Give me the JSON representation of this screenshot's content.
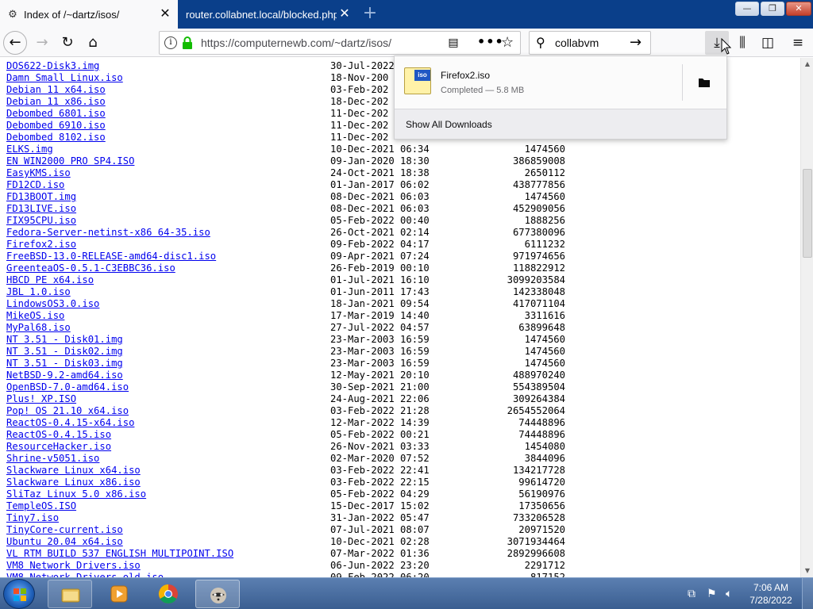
{
  "tabs": [
    {
      "title": "Index of /~dartz/isos/",
      "active": true
    },
    {
      "title": "router.collabnet.local/blocked.php",
      "active": false
    }
  ],
  "window_controls": {
    "minimize": "—",
    "maximize": "❐",
    "close": "✕"
  },
  "navbar": {
    "url": "https://computernewb.com/~dartz/isos/",
    "search_query": "collabvm"
  },
  "downloads_panel": {
    "file_name": "Firefox2.iso",
    "file_tag": "iso",
    "status": "Completed — 5.8 MB",
    "footer": "Show All Downloads"
  },
  "files": [
    {
      "name": "DOS622-Disk3.img",
      "date": "30-Jul-2022 ",
      "size": ""
    },
    {
      "name": "Damn Small Linux.iso",
      "date": "18-Nov-200",
      "size": ""
    },
    {
      "name": "Debian 11 x64.iso",
      "date": "03-Feb-202",
      "size": ""
    },
    {
      "name": "Debian 11 x86.iso",
      "date": "18-Dec-202",
      "size": ""
    },
    {
      "name": "Debombed 6801.iso",
      "date": "11-Dec-202",
      "size": ""
    },
    {
      "name": "Debombed 6910.iso",
      "date": "11-Dec-202",
      "size": ""
    },
    {
      "name": "Debombed 8102.iso",
      "date": "11-Dec-202",
      "size": ""
    },
    {
      "name": "ELKS.img",
      "date": "10-Dec-2021 06:34",
      "size": "1474560"
    },
    {
      "name": "EN WIN2000 PRO SP4.ISO",
      "date": "09-Jan-2020 18:30",
      "size": "386859008"
    },
    {
      "name": "EasyKMS.iso",
      "date": "24-Oct-2021 18:38",
      "size": "2650112"
    },
    {
      "name": "FD12CD.iso",
      "date": "01-Jan-2017 06:02",
      "size": "438777856"
    },
    {
      "name": "FD13BOOT.img",
      "date": "08-Dec-2021 06:03",
      "size": "1474560"
    },
    {
      "name": "FD13LIVE.iso",
      "date": "08-Dec-2021 06:03",
      "size": "452909056"
    },
    {
      "name": "FIX95CPU.iso",
      "date": "05-Feb-2022 00:40",
      "size": "1888256"
    },
    {
      "name": "Fedora-Server-netinst-x86 64-35.iso",
      "date": "26-Oct-2021 02:14",
      "size": "677380096"
    },
    {
      "name": "Firefox2.iso",
      "date": "09-Feb-2022 04:17",
      "size": "6111232"
    },
    {
      "name": "FreeBSD-13.0-RELEASE-amd64-disc1.iso",
      "date": "09-Apr-2021 07:24",
      "size": "971974656"
    },
    {
      "name": "GreenteaOS-0.5.1-C3EBBC36.iso",
      "date": "26-Feb-2019 00:10",
      "size": "118822912"
    },
    {
      "name": "HBCD PE x64.iso",
      "date": "01-Jul-2021 16:10",
      "size": "3099203584"
    },
    {
      "name": "JBL 1.0.iso",
      "date": "01-Jun-2011 17:43",
      "size": "142338048"
    },
    {
      "name": "LindowsOS3.0.iso",
      "date": "18-Jan-2021 09:54",
      "size": "417071104"
    },
    {
      "name": "MikeOS.iso",
      "date": "17-Mar-2019 14:40",
      "size": "3311616"
    },
    {
      "name": "MyPal68.iso",
      "date": "27-Jul-2022 04:57",
      "size": "63899648"
    },
    {
      "name": "NT 3.51 - Disk01.img",
      "date": "23-Mar-2003 16:59",
      "size": "1474560"
    },
    {
      "name": "NT 3.51 - Disk02.img",
      "date": "23-Mar-2003 16:59",
      "size": "1474560"
    },
    {
      "name": "NT 3.51 - Disk03.img",
      "date": "23-Mar-2003 16:59",
      "size": "1474560"
    },
    {
      "name": "NetBSD-9.2-amd64.iso",
      "date": "12-May-2021 20:10",
      "size": "488970240"
    },
    {
      "name": "OpenBSD-7.0-amd64.iso",
      "date": "30-Sep-2021 21:00",
      "size": "554389504"
    },
    {
      "name": "Plus! XP.ISO",
      "date": "24-Aug-2021 22:06",
      "size": "309264384"
    },
    {
      "name": "Pop! OS 21.10 x64.iso",
      "date": "03-Feb-2022 21:28",
      "size": "2654552064"
    },
    {
      "name": "ReactOS-0.4.15-x64.iso",
      "date": "12-Mar-2022 14:39",
      "size": "74448896"
    },
    {
      "name": "ReactOS-0.4.15.iso",
      "date": "05-Feb-2022 00:21",
      "size": "74448896"
    },
    {
      "name": "ResourceHacker.iso",
      "date": "26-Nov-2021 03:33",
      "size": "1454080"
    },
    {
      "name": "Shrine-v5051.iso",
      "date": "02-Mar-2020 07:52",
      "size": "3844096"
    },
    {
      "name": "Slackware Linux x64.iso",
      "date": "03-Feb-2022 22:41",
      "size": "134217728"
    },
    {
      "name": "Slackware Linux x86.iso",
      "date": "03-Feb-2022 22:15",
      "size": "99614720"
    },
    {
      "name": "SliTaz Linux 5.0 x86.iso",
      "date": "05-Feb-2022 04:29",
      "size": "56190976"
    },
    {
      "name": "TempleOS.ISO",
      "date": "15-Dec-2017 15:02",
      "size": "17350656"
    },
    {
      "name": "Tiny7.iso",
      "date": "31-Jan-2022 05:47",
      "size": "733206528"
    },
    {
      "name": "TinyCore-current.iso",
      "date": "07-Jul-2021 08:07",
      "size": "20971520"
    },
    {
      "name": "Ubuntu 20.04 x64.iso",
      "date": "10-Dec-2021 02:28",
      "size": "3071934464"
    },
    {
      "name": "VL RTM BUILD 537 ENGLISH MULTIPOINT.ISO",
      "date": "07-Mar-2022 01:36",
      "size": "2892996608"
    },
    {
      "name": "VM8 Network Drivers.iso",
      "date": "06-Jun-2022 23:20",
      "size": "2291712"
    },
    {
      "name": "VM8 Network Drivers old.iso",
      "date": "09-Feb-2022 06:20",
      "size": "817152"
    }
  ],
  "taskbar": {
    "clock_time": "7:06 AM",
    "clock_date": "7/28/2022"
  }
}
